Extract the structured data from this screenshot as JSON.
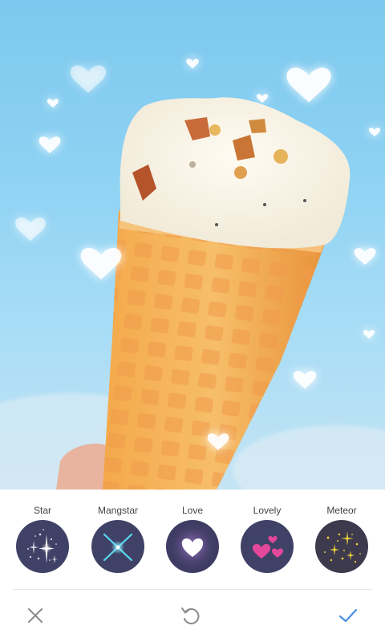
{
  "effects": [
    {
      "id": "star",
      "label": "Star"
    },
    {
      "id": "mangstar",
      "label": "Mangstar"
    },
    {
      "id": "love",
      "label": "Love"
    },
    {
      "id": "lovely",
      "label": "Lovely"
    },
    {
      "id": "meteor",
      "label": "Meteor"
    }
  ],
  "toolbar": {
    "cancel_icon": "close-icon",
    "reset_icon": "undo-icon",
    "confirm_icon": "check-icon"
  },
  "colors": {
    "thumb_background": "#3f4266",
    "confirm_accent": "#4a8fe0",
    "cancel_color": "#8a8a8a"
  }
}
